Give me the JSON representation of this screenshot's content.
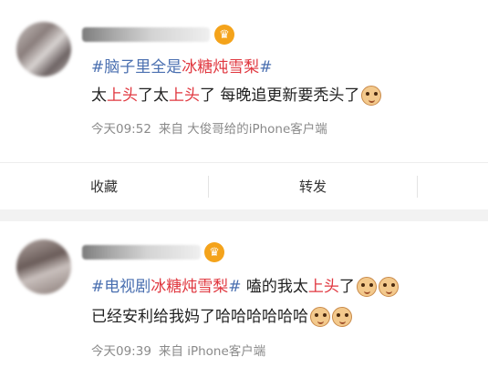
{
  "posts": [
    {
      "topic": "#脑子里全是冰糖炖雪梨#",
      "topic_parts": [
        "#脑子里全是",
        "冰糖炖雪梨",
        "#"
      ],
      "text_parts": [
        "太",
        "上头",
        "了太",
        "上头",
        "了 每晚追更新要秃头了"
      ],
      "emoji_icon": "cat-face-icon",
      "time": "今天09:52",
      "source": "来自 大俊哥给的iPhone客户端"
    },
    {
      "topic": "#电视剧冰糖炖雪梨#",
      "topic_parts": [
        "#电视剧",
        "冰糖炖雪梨",
        "#"
      ],
      "text_parts": [
        " 嗑的我太",
        "上头",
        "了"
      ],
      "line2": "已经安利给我妈了哈哈哈哈哈哈",
      "emoji_icon": "cat-face-icon",
      "time": "今天09:39",
      "source": "来自 iPhone客户端"
    }
  ],
  "actions": {
    "collect_label": "收藏",
    "forward_label": "转发"
  },
  "colors": {
    "topic": "#4a6fb0",
    "highlight": "#e0373f",
    "meta": "#8a8a8a"
  }
}
